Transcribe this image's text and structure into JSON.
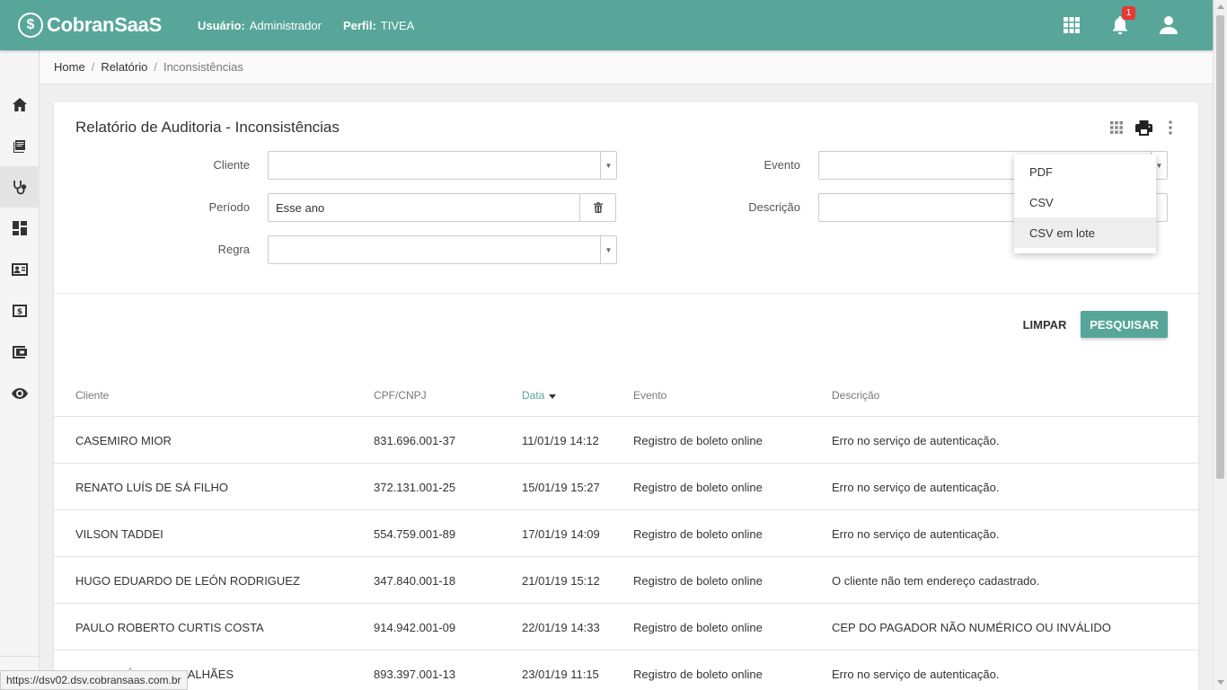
{
  "header": {
    "logo_mark": "$",
    "logo_text": "CobranSaaS",
    "user_label": "Usuário:",
    "user_value": "Administrador",
    "profile_label": "Perfil:",
    "profile_value": "TIVEA",
    "notification_count": "1",
    "brand_color": "#57a699"
  },
  "sidebar": {
    "items": [
      {
        "icon": "home-icon"
      },
      {
        "icon": "book-icon"
      },
      {
        "icon": "stethoscope-icon"
      },
      {
        "icon": "dashboard-icon"
      },
      {
        "icon": "contact-card-icon"
      },
      {
        "icon": "money-icon"
      },
      {
        "icon": "wallet-icon"
      },
      {
        "icon": "eye-icon"
      }
    ],
    "active_index": 2
  },
  "breadcrumb": {
    "home": "Home",
    "report": "Relatório",
    "current": "Inconsistências"
  },
  "card": {
    "title": "Relatório de Auditoria - Inconsistências"
  },
  "filters": {
    "cliente": {
      "label": "Cliente",
      "value": ""
    },
    "periodo": {
      "label": "Período",
      "value": "Esse ano"
    },
    "regra": {
      "label": "Regra",
      "value": ""
    },
    "evento": {
      "label": "Evento",
      "value": ""
    },
    "descricao": {
      "label": "Descrição",
      "value": ""
    }
  },
  "actions": {
    "clear": "LIMPAR",
    "search": "PESQUISAR"
  },
  "export_menu": {
    "items": [
      "PDF",
      "CSV",
      "CSV em lote"
    ],
    "hovered_index": 2
  },
  "table": {
    "columns": [
      "Cliente",
      "CPF/CNPJ",
      "Data",
      "Evento",
      "Descrição"
    ],
    "sorted_column": "Data",
    "rows": [
      [
        "CASEMIRO MIOR",
        "831.696.001-37",
        "11/01/19 14:12",
        "Registro de boleto online",
        "Erro no serviço de autenticação."
      ],
      [
        "RENATO LUÍS DE SÁ FILHO",
        "372.131.001-25",
        "15/01/19 15:27",
        "Registro de boleto online",
        "Erro no serviço de autenticação."
      ],
      [
        "VILSON TADDEI",
        "554.759.001-89",
        "17/01/19 14:09",
        "Registro de boleto online",
        "Erro no serviço de autenticação."
      ],
      [
        "HUGO EDUARDO DE LEÓN RODRIGUEZ",
        "347.840.001-18",
        "21/01/19 15:12",
        "Registro de boleto online",
        "O cliente não tem endereço cadastrado."
      ],
      [
        "PAULO ROBERTO CURTIS COSTA",
        "914.942.001-09",
        "22/01/19 14:33",
        "Registro de boleto online",
        "CEP DO PAGADOR NÃO NUMÉRICO OU INVÁLIDO"
      ],
      [
        "PAULO CÉSAR MAGALHÃES",
        "893.397.001-13",
        "23/01/19 11:15",
        "Registro de boleto online",
        "Erro no serviço de autenticação."
      ]
    ]
  },
  "status_url": "https://dsv02.dsv.cobransaas.com.br"
}
